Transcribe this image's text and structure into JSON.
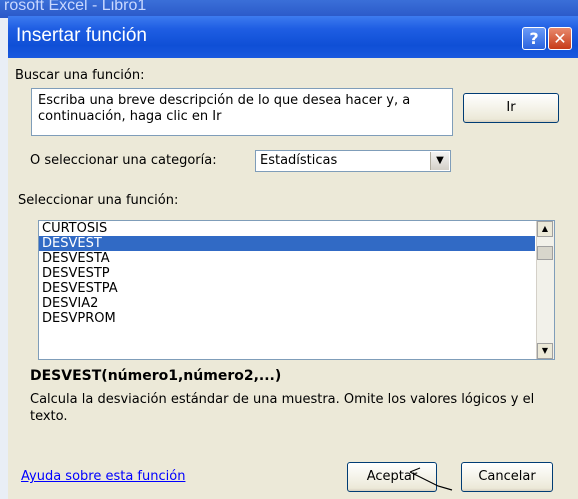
{
  "background_window": {
    "title": "rosoft Excel - Libro1"
  },
  "dialog": {
    "title": "Insertar función",
    "help_button": "?",
    "close_button": "✕"
  },
  "search": {
    "label": "Buscar una función:",
    "value": "Escriba una breve descripción de lo que desea hacer y, a continuación, haga clic en Ir",
    "go_button": "Ir"
  },
  "category": {
    "label": "O seleccionar una categoría:",
    "selected": "Estadísticas"
  },
  "functions": {
    "label": "Seleccionar una función:",
    "items": [
      "CURTOSIS",
      "DESVEST",
      "DESVESTA",
      "DESVESTP",
      "DESVESTPA",
      "DESVIA2",
      "DESVPROM"
    ],
    "selected_index": 1
  },
  "details": {
    "signature": "DESVEST(número1,número2,...)",
    "description": "Calcula la desviación estándar de una muestra. Omite los valores lógicos y el texto."
  },
  "footer": {
    "help_link": "Ayuda sobre esta función",
    "ok_button": "Aceptar",
    "cancel_button": "Cancelar"
  },
  "colors": {
    "title_bar": "#1f5ee3",
    "selection": "#316ac5",
    "dialog_bg": "#ece9d8",
    "link": "#0000ff"
  }
}
